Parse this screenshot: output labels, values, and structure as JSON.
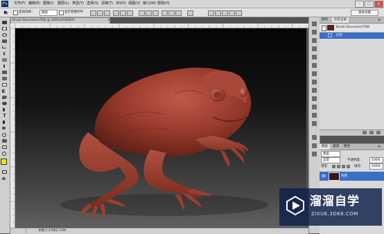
{
  "app": {
    "logo": "Ps"
  },
  "menu": [
    "文件(F)",
    "编辑(E)",
    "图像(I)",
    "图层(L)",
    "类型(Y)",
    "选择(S)",
    "滤镜(T)",
    "3D(D)",
    "视图(V)",
    "窗口(W)",
    "帮助(H)"
  ],
  "window_controls": {
    "minimize": "–",
    "restore": "□",
    "close": "×"
  },
  "options": {
    "auto_select_label": "自动选择：",
    "auto_select_value": "图层",
    "show_transform_label": "显示变换控件",
    "workspace": "基本功能"
  },
  "document": {
    "tab_title": "Brush Document.PSD @ 100%(RGB/8#)",
    "close": "×",
    "status": "文档:2.37M/2.37M"
  },
  "history_panel": {
    "tabs": [
      "颜色",
      "历史记录"
    ],
    "snapshot_label": "Brush Document.PSD",
    "step_label": "打开"
  },
  "layers_panel": {
    "tabs": [
      "图层",
      "通道",
      "路径"
    ],
    "kind_label": "类型",
    "blend_mode": "正常",
    "opacity_label": "不透明度:",
    "opacity_value": "100%",
    "lock_label": "锁定:",
    "fill_label": "填充:",
    "fill_value": "100%",
    "layer_name": "背景"
  },
  "watermark": {
    "brand": "溜溜自学",
    "url": "ZIXUE.3D66.COM"
  },
  "colors": {
    "accent": "#3a6fc4",
    "frog": "#9a3e30",
    "foreground_swatch": "#f7e000",
    "background_swatch": "#ffffff"
  }
}
